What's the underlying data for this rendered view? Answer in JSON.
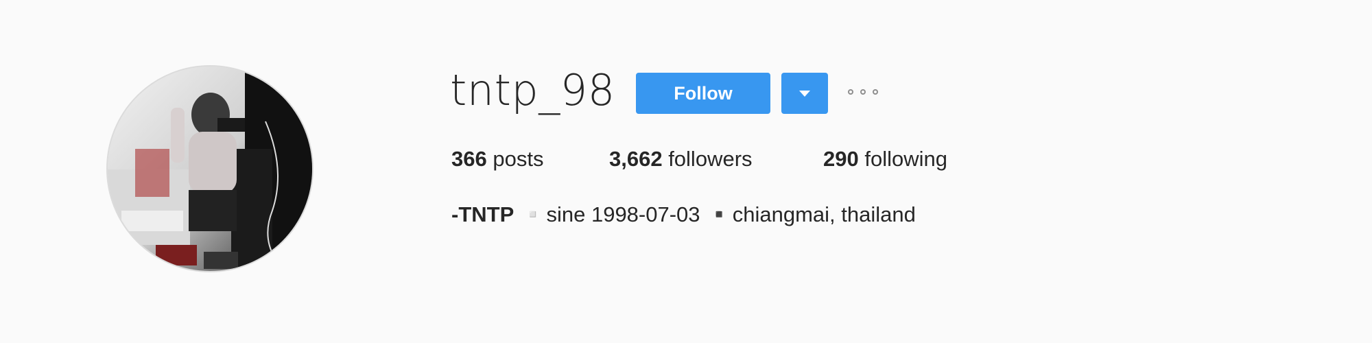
{
  "profile": {
    "username": "tntp_98",
    "avatar_alt": "",
    "follow_label": "Follow",
    "dropdown_icon": "caret-down-icon",
    "more_icon": "more-options-icon"
  },
  "stats": {
    "posts": {
      "count": "366",
      "label": " posts"
    },
    "followers": {
      "count": "3,662",
      "label": " followers"
    },
    "following": {
      "count": "290",
      "label": " following"
    }
  },
  "bio": {
    "name": "-TNTP",
    "text": " ▫️sine 1998-07-03 ▪️chiangmai, thailand"
  },
  "colors": {
    "background": "#fafafa",
    "accent": "#3897f0",
    "text": "#262626",
    "muted": "#8e8e8e"
  }
}
